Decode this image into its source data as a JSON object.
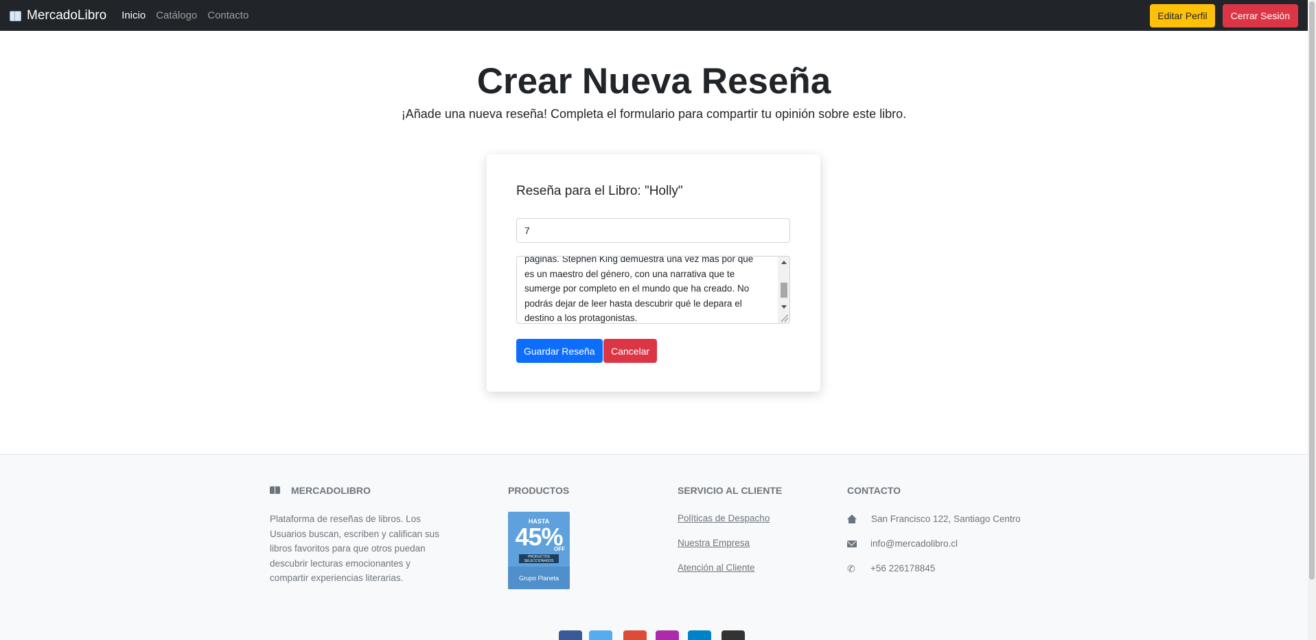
{
  "nav": {
    "brand": "MercadoLibro",
    "links": [
      "Inicio",
      "Catálogo",
      "Contacto"
    ],
    "edit_profile": "Editar Perfil",
    "logout": "Cerrar Sesión"
  },
  "hero": {
    "title": "Crear Nueva Reseña",
    "subtitle": "¡Añade una nueva reseña! Completa el formulario para compartir tu opinión sobre este libro."
  },
  "form": {
    "heading": "Reseña para el Libro: \"Holly\"",
    "rating_value": "7",
    "review_lines": [
      "páginas. Stephen King demuestra una vez más por qué",
      "es un maestro del género, con una narrativa que te",
      "sumerge por completo en el mundo que ha creado. No",
      "podrás dejar de leer hasta descubrir qué le depara el",
      "destino a los protagonistas."
    ],
    "save_label": "Guardar Reseña",
    "cancel_label": "Cancelar"
  },
  "footer": {
    "about": {
      "heading": "MERCADOLIBRO",
      "icon": "book-icon",
      "lines": [
        "Plataforma de reseñas de libros. Los",
        "Usuarios buscan, escriben y califican sus",
        "libros favoritos para que otros puedan",
        "descubrir lecturas emocionantes y",
        "compartir experiencias literarias."
      ]
    },
    "products": {
      "heading": "PRODUCTOS",
      "promo": {
        "upto": "HASTA",
        "percent": "45%",
        "off": "OFF",
        "tag": "PRODUCTOS SELECCIONADOS",
        "brand": "Grupo Planeta"
      }
    },
    "service": {
      "heading": "SERVICIO AL CLIENTE",
      "links": [
        "Políticas de Despacho",
        "Nuestra Empresa",
        "Atención al Cliente"
      ]
    },
    "contact": {
      "heading": "CONTACTO",
      "address": "San Francisco 122, Santiago Centro",
      "email": "info@mercadolibro.cl",
      "phone": "+56 226178845"
    },
    "social": [
      {
        "name": "facebook-icon",
        "color": "#3b5998"
      },
      {
        "name": "twitter-icon",
        "color": "#55acee"
      },
      {
        "name": "google-icon",
        "color": "#dd4b39"
      },
      {
        "name": "instagram-icon",
        "color": "#ac2bac"
      },
      {
        "name": "linkedin-icon",
        "color": "#0082ca"
      },
      {
        "name": "github-icon",
        "color": "#333333"
      }
    ]
  },
  "colors": {
    "navbar": "#212529",
    "primary": "#0d6efd",
    "danger": "#dc3545",
    "warning": "#ffc107"
  }
}
